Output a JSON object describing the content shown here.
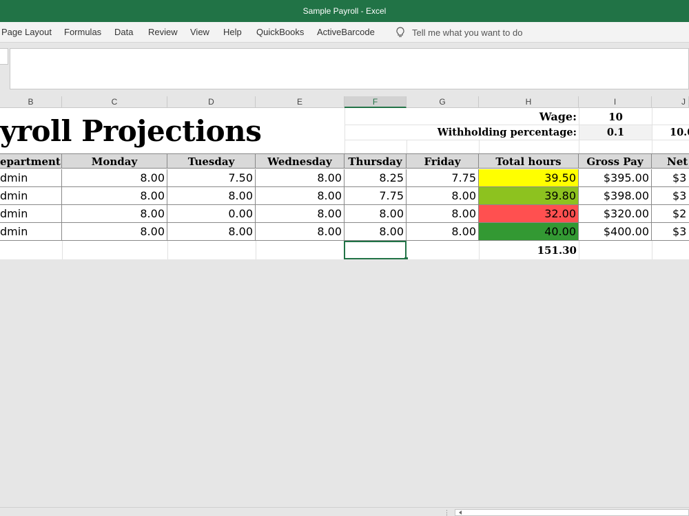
{
  "window": {
    "title": "Sample Payroll  -  Excel"
  },
  "ribbon": {
    "tabs": [
      "Page Layout",
      "Formulas",
      "Data",
      "Review",
      "View",
      "Help",
      "QuickBooks",
      "ActiveBarcode"
    ],
    "tell_me_placeholder": "Tell me what you want to do"
  },
  "columns": [
    "B",
    "C",
    "D",
    "E",
    "F",
    "G",
    "H",
    "I",
    "J"
  ],
  "selected_column": "F",
  "sheet": {
    "title": "yroll Projections",
    "wage_label": "Wage:",
    "wage_value": "10",
    "withholding_label": "Withholding percentage:",
    "withholding_value": "0.1",
    "j_partial": "10.0",
    "headers": [
      "epartment",
      "Monday",
      "Tuesday",
      "Wednesday",
      "Thursday",
      "Friday",
      "Total hours",
      "Gross Pay",
      "Net"
    ],
    "rows": [
      {
        "dept": "dmin",
        "mon": "8.00",
        "tue": "7.50",
        "wed": "8.00",
        "thu": "8.25",
        "fri": "7.75",
        "total": "39.50",
        "gross": "$395.00",
        "net": "$3"
      },
      {
        "dept": "dmin",
        "mon": "8.00",
        "tue": "8.00",
        "wed": "8.00",
        "thu": "7.75",
        "fri": "8.00",
        "total": "39.80",
        "gross": "$398.00",
        "net": "$3"
      },
      {
        "dept": "dmin",
        "mon": "8.00",
        "tue": "0.00",
        "wed": "8.00",
        "thu": "8.00",
        "fri": "8.00",
        "total": "32.00",
        "gross": "$320.00",
        "net": "$2"
      },
      {
        "dept": "dmin",
        "mon": "8.00",
        "tue": "8.00",
        "wed": "8.00",
        "thu": "8.00",
        "fri": "8.00",
        "total": "40.00",
        "gross": "$400.00",
        "net": "$3"
      }
    ],
    "total_hours_sum": "151.30"
  },
  "colors": {
    "excel_green": "#217346",
    "total_fills": [
      "#ffff00",
      "#8dc21f",
      "#ff5050",
      "#339933"
    ]
  }
}
